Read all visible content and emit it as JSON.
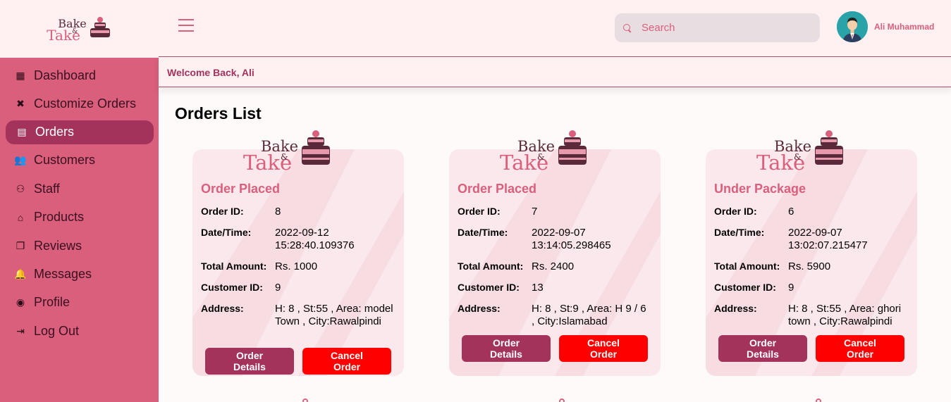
{
  "brand": {
    "line1": "Bake",
    "amp": "&",
    "line2": "Take"
  },
  "sidebar": {
    "items": [
      {
        "label": "Dashboard",
        "icon": "dashboard-icon",
        "glyph": "▦"
      },
      {
        "label": "Customize Orders",
        "icon": "tools-icon",
        "glyph": "✖"
      },
      {
        "label": "Orders",
        "icon": "clipboard-icon",
        "glyph": "▤",
        "active": true
      },
      {
        "label": "Customers",
        "icon": "users-icon",
        "glyph": "👥"
      },
      {
        "label": "Staff",
        "icon": "staff-icon",
        "glyph": "⚇"
      },
      {
        "label": "Products",
        "icon": "store-icon",
        "glyph": "⌂"
      },
      {
        "label": "Reviews",
        "icon": "reviews-icon",
        "glyph": "❐"
      },
      {
        "label": "Messages",
        "icon": "bell-icon",
        "glyph": "🔔"
      },
      {
        "label": "Profile",
        "icon": "user-circle-icon",
        "glyph": "◉"
      },
      {
        "label": "Log Out",
        "icon": "logout-icon",
        "glyph": "⇥"
      }
    ]
  },
  "header": {
    "search_placeholder": "Search",
    "user_name": "Ali Muhammad",
    "welcome": "Welcome Back, Ali"
  },
  "main": {
    "title": "Orders List",
    "labels": {
      "order_id": "Order ID:",
      "date_time": "Date/Time:",
      "total": "Total Amount:",
      "customer_id": "Customer ID:",
      "address": "Address:",
      "details_btn": "Order Details",
      "cancel_btn": "Cancel Order"
    },
    "orders": [
      {
        "status": "Order Placed",
        "order_id": "8",
        "date_time": "2022-09-12 15:28:40.109376",
        "total": "Rs. 1000",
        "customer_id": "9",
        "address": "H: 8 , St:55 , Area: model Town , City:Rawalpindi"
      },
      {
        "status": "Order Placed",
        "order_id": "7",
        "date_time": "2022-09-07 13:14:05.298465",
        "total": "Rs. 2400",
        "customer_id": "13",
        "address": "H: 8 , St:9 , Area: H 9 / 6 , City:Islamabad"
      },
      {
        "status": "Under Package",
        "order_id": "6",
        "date_time": "2022-09-07 13:02:07.215477",
        "total": "Rs. 5900",
        "customer_id": "9",
        "address": "H: 8 , St:55 , Area: ghori town , City:Rawalpindi"
      }
    ]
  },
  "colors": {
    "sidebar": "#d95f7c",
    "active": "#a3335b",
    "header_bg": "#fff0f2",
    "card_bg": "#fbe8ec",
    "cancel": "#ff0000",
    "accent": "#d95f7c"
  }
}
